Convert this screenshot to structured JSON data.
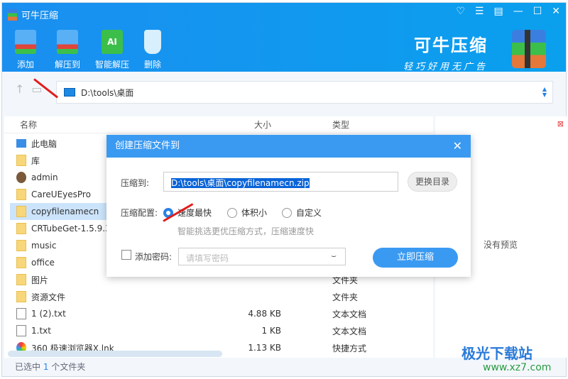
{
  "app": {
    "title": "可牛压缩",
    "brand_name": "可牛压缩",
    "brand_slogan": "轻巧好用无广告"
  },
  "window_controls": [
    "heart-icon",
    "menu-icon",
    "feedback-icon",
    "minimize-icon",
    "maximize-icon",
    "close-icon"
  ],
  "toolbar": [
    {
      "label": "添加",
      "icon": "add-icon",
      "color": "#3a9af2"
    },
    {
      "label": "解压到",
      "icon": "extract-icon",
      "color": "#3a9af2"
    },
    {
      "label": "智能解压",
      "icon": "ai-extract-icon",
      "color": "#3cbf4a"
    },
    {
      "label": "删除",
      "icon": "trash-icon",
      "color": "#cde9fb"
    }
  ],
  "address": {
    "path": "D:\\tools\\桌面"
  },
  "list": {
    "columns": {
      "name": "名称",
      "size": "大小",
      "type": "类型"
    },
    "rows": [
      {
        "name": "此电脑",
        "icon": "pc",
        "size": "",
        "type": ""
      },
      {
        "name": "库",
        "icon": "folder",
        "size": "",
        "type": ""
      },
      {
        "name": "admin",
        "icon": "user",
        "size": "",
        "type": ""
      },
      {
        "name": "CareUEyesPro",
        "icon": "folder",
        "size": "",
        "type": ""
      },
      {
        "name": "copyfilenamecn",
        "icon": "folder",
        "size": "",
        "type": "",
        "selected": true
      },
      {
        "name": "CRTubeGet-1.5.9.3-",
        "icon": "folder",
        "size": "",
        "type": ""
      },
      {
        "name": "music",
        "icon": "folder",
        "size": "",
        "type": ""
      },
      {
        "name": "office",
        "icon": "folder",
        "size": "",
        "type": ""
      },
      {
        "name": "图片",
        "icon": "folder",
        "size": "",
        "type": "文件夹"
      },
      {
        "name": "资源文件",
        "icon": "folder",
        "size": "",
        "type": "文件夹"
      },
      {
        "name": "1 (2).txt",
        "icon": "file",
        "size": "4.88 KB",
        "type": "文本文档"
      },
      {
        "name": "1.txt",
        "icon": "file",
        "size": "1 KB",
        "type": "文本文档"
      },
      {
        "name": "360 极速浏览器X.lnk",
        "icon": "browser",
        "size": "1.13 KB",
        "type": "快捷方式"
      }
    ]
  },
  "preview": {
    "empty_text": "没有预览"
  },
  "status": {
    "prefix": "已选中",
    "count": "1",
    "suffix": "个文件夹"
  },
  "dialog": {
    "title": "创建压缩文件到",
    "dest_label": "压缩到:",
    "dest_value": "D:\\tools\\桌面\\copyfilenamecn.zip",
    "change_dir": "更换目录",
    "config_label": "压缩配置:",
    "options": [
      "速度最快",
      "体积小",
      "自定义"
    ],
    "selected_option": 0,
    "hint": "智能挑选更优压缩方式，压缩速度快",
    "password_label": "添加密码:",
    "password_placeholder": "请填写密码",
    "password_checked": false,
    "submit": "立即压缩"
  },
  "watermark": {
    "name": "极光下载站",
    "url": "www.xz7.com"
  }
}
